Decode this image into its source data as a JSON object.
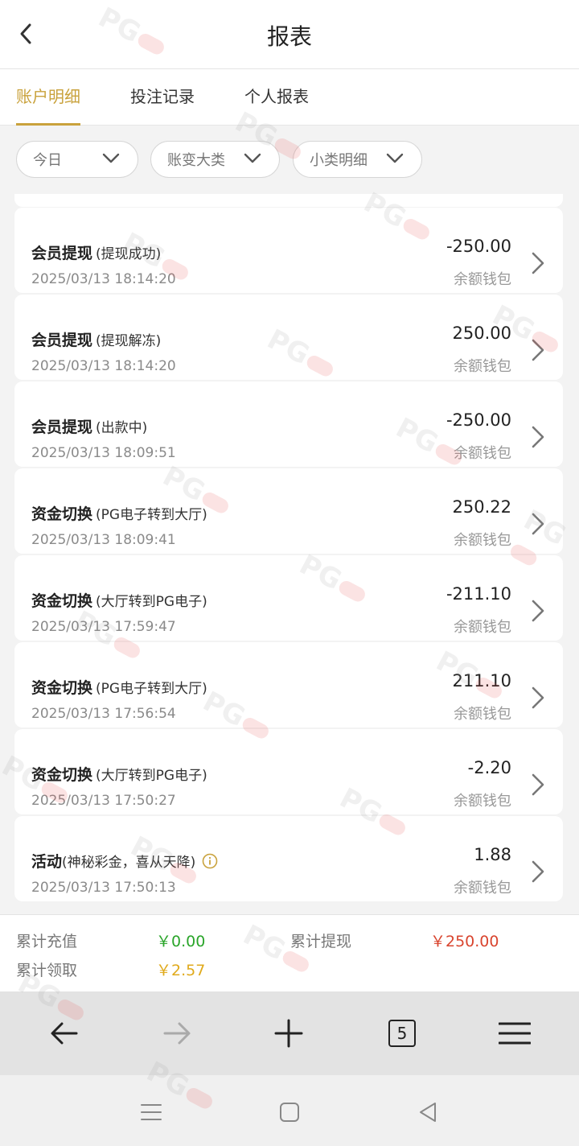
{
  "header": {
    "title": "报表"
  },
  "tabs": [
    {
      "label": "账户明细",
      "active": true
    },
    {
      "label": "投注记录",
      "active": false
    },
    {
      "label": "个人报表",
      "active": false
    }
  ],
  "filters": {
    "date": "今日",
    "category": "账变大类",
    "subcategory": "小类明细"
  },
  "records": [
    {
      "type": "会员提现",
      "detail": "(提现成功)",
      "time": "2025/03/13 18:14:20",
      "amount": "-250.00",
      "wallet": "余额钱包"
    },
    {
      "type": "会员提现",
      "detail": "(提现解冻)",
      "time": "2025/03/13 18:14:20",
      "amount": "250.00",
      "wallet": "余额钱包"
    },
    {
      "type": "会员提现",
      "detail": "(出款中)",
      "time": "2025/03/13 18:09:51",
      "amount": "-250.00",
      "wallet": "余额钱包"
    },
    {
      "type": "资金切换",
      "detail": "(PG电子转到大厅)",
      "time": "2025/03/13 18:09:41",
      "amount": "250.22",
      "wallet": "余额钱包"
    },
    {
      "type": "资金切换",
      "detail": "(大厅转到PG电子)",
      "time": "2025/03/13 17:59:47",
      "amount": "-211.10",
      "wallet": "余额钱包"
    },
    {
      "type": "资金切换",
      "detail": "(PG电子转到大厅)",
      "time": "2025/03/13 17:56:54",
      "amount": "211.10",
      "wallet": "余额钱包"
    },
    {
      "type": "资金切换",
      "detail": "(大厅转到PG电子)",
      "time": "2025/03/13 17:50:27",
      "amount": "-2.20",
      "wallet": "余额钱包"
    },
    {
      "type": "活动",
      "detail": "(神秘彩金，喜从天降)",
      "time": "2025/03/13 17:50:13",
      "amount": "1.88",
      "wallet": "余额钱包"
    }
  ],
  "summary": {
    "recharge_label": "累计充值",
    "recharge_value": "￥0.00",
    "withdraw_label": "累计提现",
    "withdraw_value": "￥250.00",
    "claim_label": "累计领取",
    "claim_value": "￥2.57"
  },
  "browser": {
    "tab_count": "5"
  },
  "watermark": {
    "text": "PG"
  },
  "colors": {
    "accent": "#c9a23c",
    "recharge": "#2aa52a",
    "withdraw": "#d9452f",
    "claim": "#e0aa1c"
  },
  "icons": [
    "back-icon",
    "chevron-down-icon",
    "chevron-right-icon",
    "info-icon",
    "nav-back-icon",
    "nav-forward-icon",
    "new-tab-icon",
    "menu-icon",
    "recents-icon",
    "home-icon",
    "system-back-icon"
  ]
}
